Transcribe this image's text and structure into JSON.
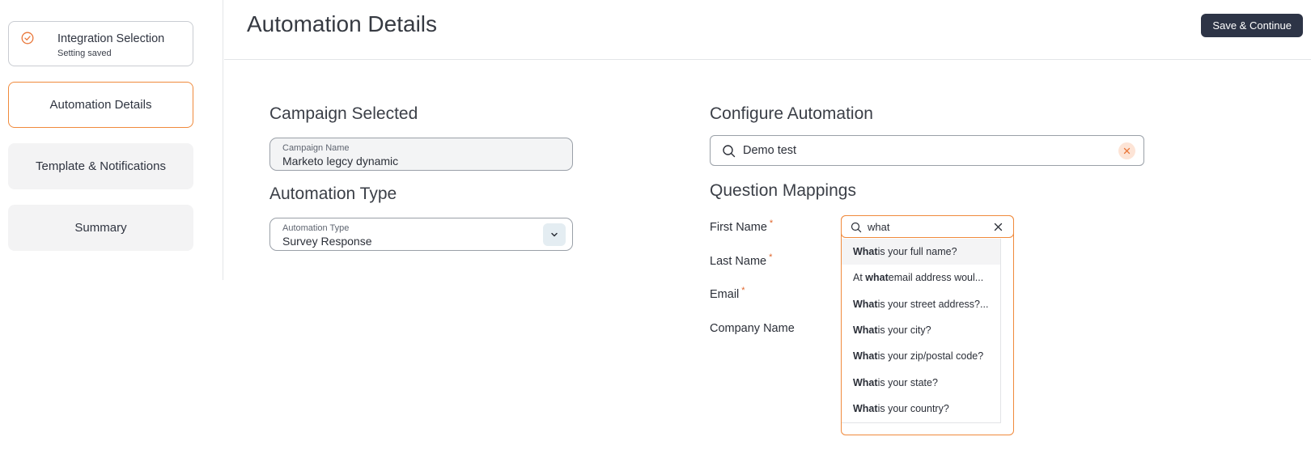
{
  "sidebar": {
    "steps": [
      {
        "label": "Integration Selection",
        "sub": "Setting saved"
      },
      {
        "label": "Automation Details"
      },
      {
        "label": "Template & Notifications"
      },
      {
        "label": "Summary"
      }
    ]
  },
  "header": {
    "title": "Automation Details",
    "save_label": "Save & Continue"
  },
  "campaign": {
    "title": "Campaign Selected",
    "field_label": "Campaign Name",
    "field_value": "Marketo legcy dynamic"
  },
  "automation_type": {
    "title": "Automation Type",
    "field_label": "Automation Type",
    "field_value": "Survey Response"
  },
  "configure": {
    "title": "Configure Automation",
    "search_value": "Demo test"
  },
  "mappings": {
    "title": "Question Mappings",
    "fields": [
      {
        "label": "First Name",
        "required": "*"
      },
      {
        "label": "Last Name",
        "required": "*"
      },
      {
        "label": "Email",
        "required": "*"
      },
      {
        "label": "Company Name",
        "required": ""
      }
    ],
    "dropdown": {
      "search_value": "what",
      "options": [
        {
          "match": "What",
          "rest": " is your full name?"
        },
        {
          "pre": "At ",
          "match": "what",
          "rest": " email address woul..."
        },
        {
          "match": "What",
          "rest": " is your street address?..."
        },
        {
          "match": "What",
          "rest": " is your city?"
        },
        {
          "match": "What",
          "rest": " is your zip/postal code?"
        },
        {
          "match": "What",
          "rest": " is your state?"
        },
        {
          "match": "What",
          "rest": " is your country?"
        }
      ]
    }
  },
  "colors": {
    "accent": "#f08a3c",
    "primary_button": "#2d3446"
  }
}
